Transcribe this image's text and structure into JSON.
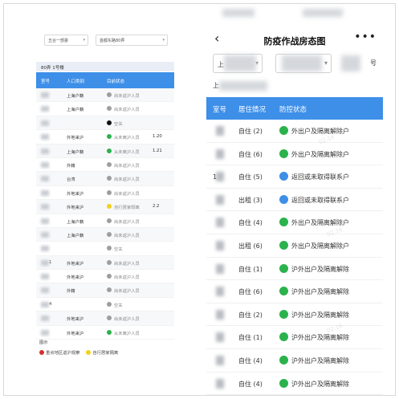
{
  "left": {
    "filters": [
      "五台一部委",
      "首都东路80弄"
    ],
    "building": "80弄 1号楼",
    "columns": [
      "室号",
      "人口类别",
      "目前状态"
    ],
    "rows": [
      {
        "room": "",
        "type": "上海户籍",
        "status": "尚未返沪人员",
        "dot": "#9e9e9e",
        "extra": ""
      },
      {
        "room": "",
        "type": "上海户籍",
        "status": "尚未返沪人员",
        "dot": "#9e9e9e",
        "extra": ""
      },
      {
        "room": "",
        "type": "",
        "status": "空关",
        "dot": "#111111",
        "extra": ""
      },
      {
        "room": "",
        "type": "外地来沪",
        "status": "从未离沪人员",
        "dot": "#2bb24c",
        "extra": "1.20"
      },
      {
        "room": "",
        "type": "上海户籍",
        "status": "从未离沪人员",
        "dot": "#2bb24c",
        "extra": "1.21"
      },
      {
        "room": "",
        "type": "外籍",
        "status": "尚未返沪人员",
        "dot": "#9e9e9e",
        "extra": ""
      },
      {
        "room": "",
        "type": "台湾",
        "status": "尚未返沪人员",
        "dot": "#9e9e9e",
        "extra": ""
      },
      {
        "room": "",
        "type": "外地来沪",
        "status": "尚未返沪人员",
        "dot": "#9e9e9e",
        "extra": ""
      },
      {
        "room": "",
        "type": "外地来沪",
        "status": "自行居家隔离",
        "dot": "#f2d21b",
        "extra": "2.2"
      },
      {
        "room": "",
        "type": "上海户籍",
        "status": "尚未返沪人员",
        "dot": "#9e9e9e",
        "extra": ""
      },
      {
        "room": "",
        "type": "上海户籍",
        "status": "尚未返沪人员",
        "dot": "#9e9e9e",
        "extra": ""
      },
      {
        "room": "",
        "type": "",
        "status": "空关",
        "dot": "#9e9e9e",
        "extra": ""
      },
      {
        "room": "1",
        "type": "外地来沪",
        "status": "尚未返沪人员",
        "dot": "#9e9e9e",
        "extra": ""
      },
      {
        "room": "",
        "type": "外地来沪",
        "status": "尚未返沪人员",
        "dot": "#9e9e9e",
        "extra": ""
      },
      {
        "room": "",
        "type": "外籍",
        "status": "尚未返沪人员",
        "dot": "#9e9e9e",
        "extra": ""
      },
      {
        "room": "4",
        "type": "",
        "status": "空关",
        "dot": "#9e9e9e",
        "extra": ""
      },
      {
        "room": "",
        "type": "外地来沪",
        "status": "尚未返沪人员",
        "dot": "#9e9e9e",
        "extra": ""
      },
      {
        "room": "",
        "type": "外地来沪",
        "status": "从未离沪人员",
        "dot": "#2bb24c",
        "extra": ""
      }
    ],
    "legend_title": "图示",
    "legend": [
      {
        "label": "重点地区返沪观察",
        "dot": "#d32f2f"
      },
      {
        "label": "自行居家隔离",
        "dot": "#f2d21b"
      }
    ]
  },
  "right": {
    "title": "防疫作战房态图",
    "back_icon": "‹",
    "more_icon": "•••",
    "filter_prefix": "上",
    "hao": "号",
    "building": "上",
    "columns": [
      "室号",
      "居住情况",
      "防控状态"
    ],
    "rows": [
      {
        "room": "",
        "occ": "自住 (2)",
        "status": "外出户及隔离解除户",
        "dot": "#2bb24c"
      },
      {
        "room": "",
        "occ": "自住 (6)",
        "status": "外出户及隔离解除户",
        "dot": "#2bb24c"
      },
      {
        "room": "1",
        "occ": "自住 (5)",
        "status": "返回或未取得联系户",
        "dot": "#3d8fe8"
      },
      {
        "room": "",
        "occ": "出租 (3)",
        "status": "返回或未取得联系户",
        "dot": "#3d8fe8"
      },
      {
        "room": "",
        "occ": "自住 (4)",
        "status": "外出户及隔离解除户",
        "dot": "#2bb24c"
      },
      {
        "room": "",
        "occ": "出租 (6)",
        "status": "外出户及隔离解除户",
        "dot": "#2bb24c"
      },
      {
        "room": "",
        "occ": "自住 (1)",
        "status": "沪外出户及隔离解除",
        "dot": "#2bb24c"
      },
      {
        "room": "",
        "occ": "自住 (6)",
        "status": "沪外出户及隔离解除",
        "dot": "#2bb24c"
      },
      {
        "room": "",
        "occ": "自住 (2)",
        "status": "沪外出户及隔离解除",
        "dot": "#2bb24c"
      },
      {
        "room": "",
        "occ": "自住 (1)",
        "status": "沪外出户及隔离解除",
        "dot": "#2bb24c"
      },
      {
        "room": "",
        "occ": "自住 (4)",
        "status": "沪外出户及隔离解除",
        "dot": "#2bb24c"
      },
      {
        "room": "",
        "occ": "自住 (4)",
        "status": "沪外出户及隔离解除",
        "dot": "#2bb24c"
      }
    ]
  }
}
